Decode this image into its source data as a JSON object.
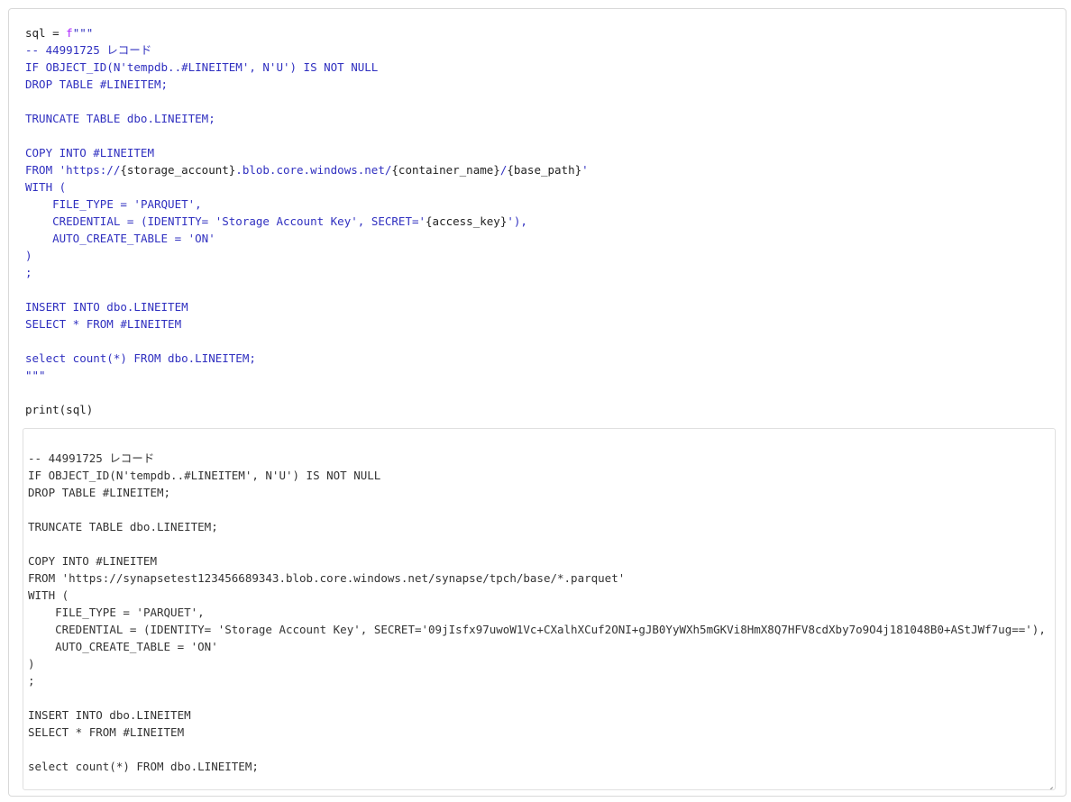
{
  "cell": {
    "code": {
      "assign_var": "sql",
      "assign_op": " = ",
      "fprefix": "f",
      "open_quotes": "\"\"\"",
      "line_comment": "-- 44991725 レコード",
      "line_if": "IF OBJECT_ID(N'tempdb..#LINEITEM', N'U') IS NOT NULL",
      "line_drop": "DROP TABLE #LINEITEM;",
      "line_truncate": "TRUNCATE TABLE dbo.LINEITEM;",
      "line_copy": "COPY INTO #LINEITEM",
      "from_prefix": "FROM 'https://",
      "from_var1": "{storage_account}",
      "from_mid": ".blob.core.windows.net/",
      "from_var2": "{container_name}",
      "from_slash": "/",
      "from_var3": "{base_path}",
      "from_suffix": "'",
      "line_with": "WITH (",
      "line_filetype": "    FILE_TYPE = 'PARQUET',",
      "cred_prefix": "    CREDENTIAL = (IDENTITY= 'Storage Account Key', SECRET='",
      "cred_var": "{access_key}",
      "cred_suffix": "'),",
      "line_autocreate": "    AUTO_CREATE_TABLE = 'ON'",
      "line_close": ")",
      "line_semicolon": ";",
      "line_insert": "INSERT INTO dbo.LINEITEM",
      "line_select": "SELECT * FROM #LINEITEM",
      "line_count": "select count(*) FROM dbo.LINEITEM;",
      "close_quotes": "\"\"\"",
      "print_fn": "print",
      "print_arg": "(sql)"
    },
    "output": {
      "text": "\n-- 44991725 レコード\nIF OBJECT_ID(N'tempdb..#LINEITEM', N'U') IS NOT NULL\nDROP TABLE #LINEITEM;\n\nTRUNCATE TABLE dbo.LINEITEM;\n\nCOPY INTO #LINEITEM\nFROM 'https://synapsetest123456689343.blob.core.windows.net/synapse/tpch/base/*.parquet'\nWITH (\n    FILE_TYPE = 'PARQUET',\n    CREDENTIAL = (IDENTITY= 'Storage Account Key', SECRET='09jIsfx97uwoW1Vc+CXalhXCuf2ONI+gJB0YyWXh5mGKVi8HmX8Q7HFV8cdXby7o9O4j181048B0+AStJWf7ug=='),\n    AUTO_CREATE_TABLE = 'ON'\n)\n;\n\nINSERT INTO dbo.LINEITEM\nSELECT * FROM #LINEITEM\n\nselect count(*) FROM dbo.LINEITEM;"
    }
  }
}
